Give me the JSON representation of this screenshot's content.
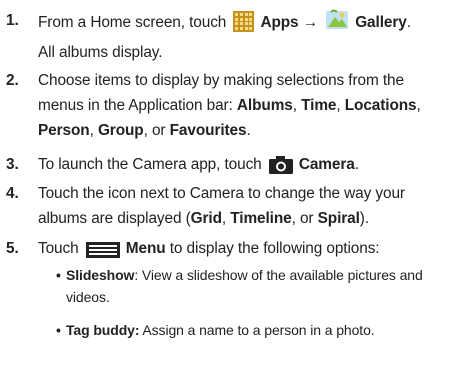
{
  "steps": [
    {
      "number": "1.",
      "seg1": "From a Home screen, touch",
      "bold1": "Apps",
      "arrow": "→",
      "bold2": "Gallery",
      "seg2": ".",
      "line2": "All albums display.",
      "icons": [
        "apps-grid-icon",
        "gallery-icon"
      ]
    },
    {
      "number": "2.",
      "seg1": "Choose items to display by making selections from the",
      "seg2": "menus in the Application bar: ",
      "bold_albums": "Albums",
      "sep1": ", ",
      "bold_time": "Time",
      "sep2": ", ",
      "bold_locations": "Locations",
      "sep3": ",",
      "bold_person": "Person",
      "sep4": ", ",
      "bold_group": "Group",
      "sep5": ", or ",
      "bold_favourites": "Favourites",
      "sep6": "."
    },
    {
      "number": "3.",
      "seg1": "To launch the Camera app, touch",
      "bold1": "Camera",
      "seg2": ".",
      "icons": [
        "camera-icon"
      ]
    },
    {
      "number": "4.",
      "seg1": "Touch the icon next to Camera to change the way your",
      "seg2": "albums are displayed (",
      "bold_grid": "Grid",
      "sep1": ", ",
      "bold_timeline": "Timeline",
      "sep2": ", or ",
      "bold_spiral": "Spiral",
      "seg3": ")."
    },
    {
      "number": "5.",
      "seg1": "Touch",
      "bold1": "Menu",
      "seg2": " to display the following options:",
      "icons": [
        "menu-icon"
      ]
    }
  ],
  "bullets": [
    {
      "dot": "•",
      "bold": "Slideshow",
      "text1": ": View a slideshow of the available pictures and",
      "text2": "videos."
    },
    {
      "dot": "•",
      "bold": "Tag buddy:",
      "text1": " Assign a name to a person in a photo."
    }
  ],
  "colors": {
    "text": "#222222",
    "apps_icon": "#c8911a",
    "gallery_icon": "#8cc63f",
    "camera_icon": "#222222"
  }
}
